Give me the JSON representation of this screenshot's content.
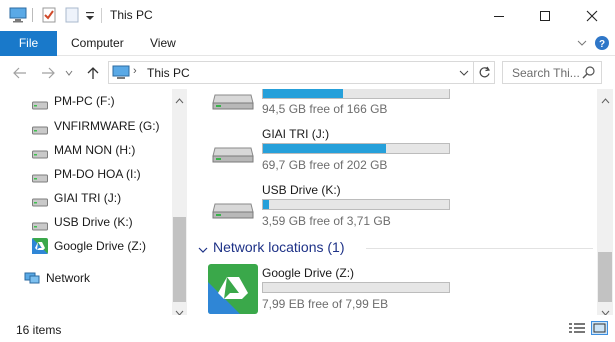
{
  "window": {
    "title": "This PC"
  },
  "ribbon": {
    "tabs": [
      "File",
      "Computer",
      "View"
    ]
  },
  "address": {
    "path": "This PC",
    "search_placeholder": "Search Thi..."
  },
  "nav": {
    "items": [
      {
        "label": "PM-PC (F:)",
        "icon": "drive-icon"
      },
      {
        "label": "VNFIRMWARE (G:)",
        "icon": "drive-icon"
      },
      {
        "label": "MAM NON (H:)",
        "icon": "drive-icon"
      },
      {
        "label": "PM-DO HOA (I:)",
        "icon": "drive-icon"
      },
      {
        "label": "GIAI TRI (J:)",
        "icon": "drive-icon"
      },
      {
        "label": "USB Drive (K:)",
        "icon": "drive-icon"
      },
      {
        "label": "Google Drive (Z:)",
        "icon": "google-drive-icon"
      }
    ],
    "network": "Network"
  },
  "content": {
    "drives": [
      {
        "name": "",
        "free": "94,5 GB free of 166 GB",
        "used_fraction": 0.43
      },
      {
        "name": "GIAI TRI (J:)",
        "free": "69,7 GB free of 202 GB",
        "used_fraction": 0.66
      },
      {
        "name": "USB Drive (K:)",
        "free": "3,59 GB free of 3,71 GB",
        "used_fraction": 0.03
      }
    ],
    "network_group": "Network locations (1)",
    "network_drive": {
      "name": "Google Drive (Z:)",
      "free": "7,99 EB free of 7,99 EB",
      "used_fraction": 0.0
    }
  },
  "status": {
    "items_count": "16 items"
  },
  "colors": {
    "accent": "#1979ca",
    "bar_fill": "#26a0da",
    "group_header": "#1e3287"
  }
}
